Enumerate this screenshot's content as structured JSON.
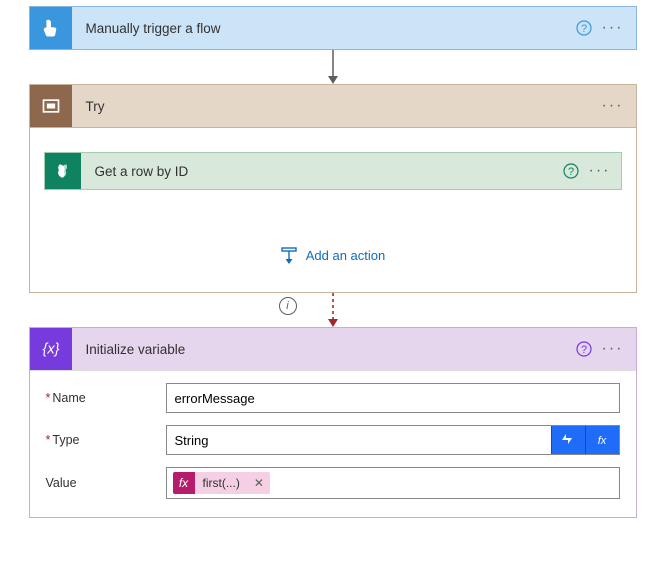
{
  "trigger": {
    "label": "Manually trigger a flow"
  },
  "scope": {
    "label": "Try",
    "add_action": "Add an action",
    "action": {
      "label": "Get a row by ID"
    }
  },
  "variable": {
    "label": "Initialize variable",
    "fields": {
      "name": {
        "label": "Name",
        "value": "errorMessage",
        "required": true
      },
      "type": {
        "label": "Type",
        "value": "String",
        "required": true
      },
      "value": {
        "label": "Value",
        "token": "first(...)",
        "required": false
      }
    }
  },
  "glyph": {
    "help": "?",
    "dots": "···",
    "info": "i",
    "required": "*",
    "fx": "fx",
    "close": "✕"
  }
}
